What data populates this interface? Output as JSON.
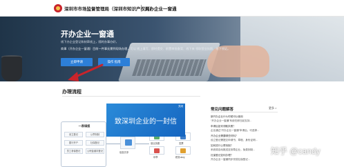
{
  "header": {
    "org_name": "深圳市市场监督管理局（深圳市知识产权局）",
    "site_name": "开办企业一窗通"
  },
  "banner": {
    "title": "开办企业一窗通",
    "subtitle": "线下办企业登记和刻章线上，随时办事办好，",
    "description": "商事（开办企业一窗通）目前一件事无需到现场办理，可以 线上填写，即时提交、前置审批备案、线下来 领取营业执照、线下领证。",
    "apply_button": "立即申请",
    "guide_button": "操作 指南",
    "colors": {
      "button": "#2d7fd8",
      "annotation_arrow": "#c8242b"
    }
  },
  "process": {
    "section_title": "办理流程",
    "box_title": "一表填报",
    "box_items": [
      "设立登记",
      "公章刻制",
      "银行开户",
      "社保登记",
      "员工参保登记",
      "公积金缴存登记"
    ],
    "node_labels": [
      "信息共享",
      "营业执照",
      "印章",
      "发票",
      "税务ukey"
    ]
  },
  "video": {
    "title": "致深圳企业的一封信",
    "close_label": "关闭"
  },
  "faq": {
    "title": "常见问题解答",
    "more_label": "更多 >",
    "items": [
      {
        "q": "新开办企业什么时候可以使用",
        "a": "“开办企业一窗通”系统在即日起支持..."
      },
      {
        "q": "申请后如何领取执照？",
        "a": "企业通过“开办企业一窗通”申请后，可选择..."
      },
      {
        "q": "开办企业需要哪些材料？",
        "a": "设立登记需提交申请书、章程、身份证明..."
      },
      {
        "q": "如何进行公章刻制？",
        "a": "系统将自动推送至刻章企业，免费刻制..."
      },
      {
        "q": "社保登记如何办理？",
        "a": "开办企业一窗通同步完成社保登记..."
      }
    ]
  },
  "watermark": "知乎 @candy"
}
